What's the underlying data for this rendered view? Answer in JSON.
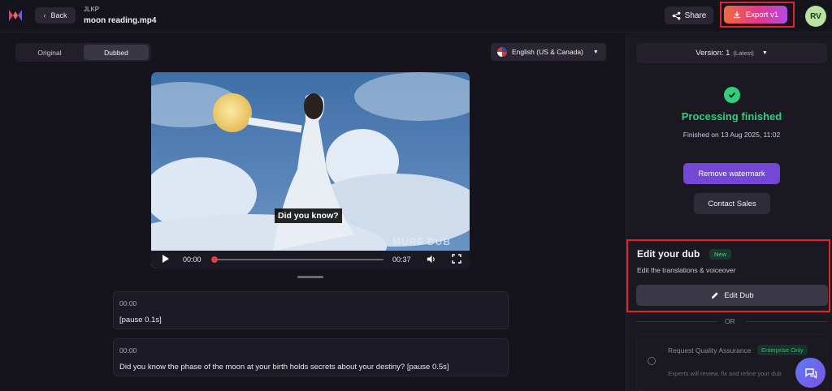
{
  "header": {
    "back_label": "Back",
    "project_name": "JLKP",
    "file_name": "moon reading.mp4",
    "share_label": "Share",
    "export_label": "Export v1",
    "avatar_initials": "RV"
  },
  "view_toggle": {
    "original_label": "Original",
    "dubbed_label": "Dubbed",
    "selected": "Dubbed"
  },
  "language": {
    "selected": "English (US & Canada)"
  },
  "video": {
    "subtitle": "Did you know?",
    "watermark": "MURF DUB",
    "current_time": "00:00",
    "total_time": "00:37",
    "progress": 0
  },
  "segments": [
    {
      "time": "00:00",
      "text": "[pause 0.1s]"
    },
    {
      "time": "00:00",
      "text": "Did you know the phase of the moon at your birth holds secrets about your destiny? [pause 0.5s]"
    }
  ],
  "panel": {
    "version_label": "Version: 1",
    "version_tag": "(Latest)",
    "status_title": "Processing finished",
    "status_sub": "Finished on 13 Aug 2025, 11:02",
    "remove_watermark_label": "Remove watermark",
    "contact_sales_label": "Contact Sales",
    "edit_title": "Edit your dub",
    "edit_badge": "New",
    "edit_sub": "Edit the translations & voiceover",
    "edit_button": "Edit Dub",
    "or_label": "OR",
    "quality_title": "Request Quality Assurance",
    "quality_badge": "Enterprise Only",
    "quality_sub": "Experts will review, fix and refine your dub"
  },
  "colors": {
    "accent_green": "#2fcf7d",
    "accent_purple": "#7447d6",
    "highlight_red": "#e0242a"
  }
}
